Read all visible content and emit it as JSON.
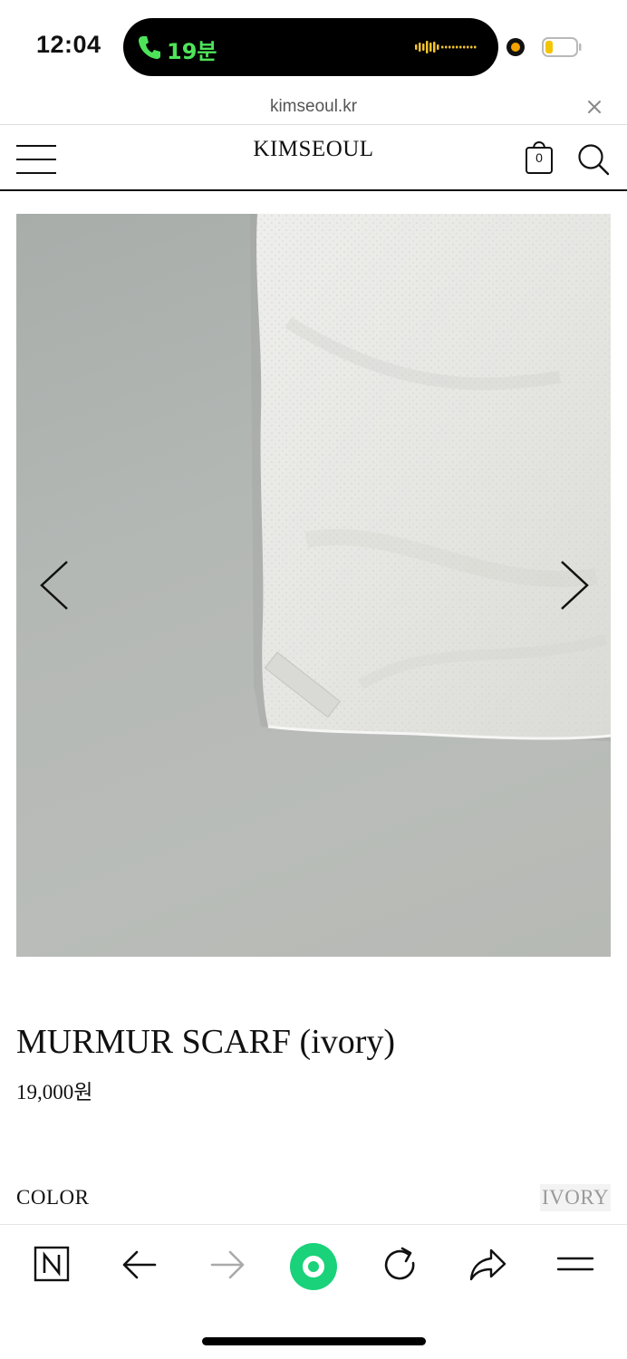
{
  "status_bar": {
    "time": "12:04",
    "call_duration": "19분",
    "accent_call_color": "#4ee45a",
    "privacy_dot_color": "#f5a300"
  },
  "browser": {
    "url": "kimseoul.kr",
    "close_icon": "close-icon"
  },
  "site_header": {
    "brand": "KIMSEOUL",
    "cart_count": "0",
    "menu_icon": "hamburger-menu-icon",
    "cart_icon": "shopping-bag-icon",
    "search_icon": "search-icon"
  },
  "product": {
    "name": "MURMUR SCARF (ivory)",
    "price": "19,000원",
    "option_label": "COLOR",
    "option_value": "IVORY"
  },
  "toolbar": {
    "items": [
      "naver-home-icon",
      "back-arrow-icon",
      "forward-arrow-icon",
      "green-record-icon",
      "refresh-icon",
      "share-icon",
      "menu-icon"
    ],
    "accent_color": "#19d27a"
  }
}
